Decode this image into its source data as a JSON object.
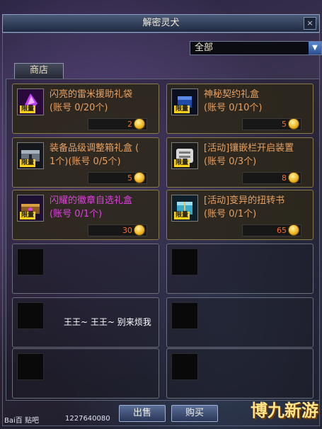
{
  "window": {
    "title": "解密灵犬",
    "close_symbol": "×"
  },
  "filter": {
    "selected": "全部"
  },
  "tab": {
    "label": "商店"
  },
  "items": [
    {
      "name": "闪亮的雷米援助礼袋",
      "limit": "(账号 0/20个)",
      "price": "2",
      "badge": "限量",
      "color": "#e9a060",
      "icon": "purple-gem-icon"
    },
    {
      "name": "神秘契约礼盒",
      "limit": "(账号 0/10个)",
      "price": "5",
      "badge": "限量",
      "color": "#e9a060",
      "icon": "blue-box-icon"
    },
    {
      "name": "装备品级调整箱礼盒 (",
      "limit": "1个)(账号 0/5个)",
      "price": "5",
      "badge": "限量",
      "color": "#e9a060",
      "icon": "metal-chest-icon"
    },
    {
      "name": "[活动]镶嵌栏开启装置",
      "limit": "(账号 0/3个)",
      "price": "8",
      "badge": "限量",
      "color": "#e9a060",
      "icon": "scroll-device-icon"
    },
    {
      "name": "闪耀的徽章自选礼盒",
      "limit": "(账号 0/1个)",
      "price": "30",
      "badge": "限量",
      "color": "#e040e0",
      "icon": "badge-chest-icon"
    },
    {
      "name": "[活动]变异的扭转书",
      "limit": "(账号 0/1个)",
      "price": "65",
      "badge": "限量",
      "color": "#e9a060",
      "icon": "twist-book-icon"
    }
  ],
  "chat_text": "王王~ 王王~ 别来烦我",
  "buttons": {
    "sell": "出售",
    "buy": "购买"
  },
  "watermark": {
    "baidu": "Bai百 贴吧",
    "id": "1227640080",
    "brand": "博九新游"
  }
}
